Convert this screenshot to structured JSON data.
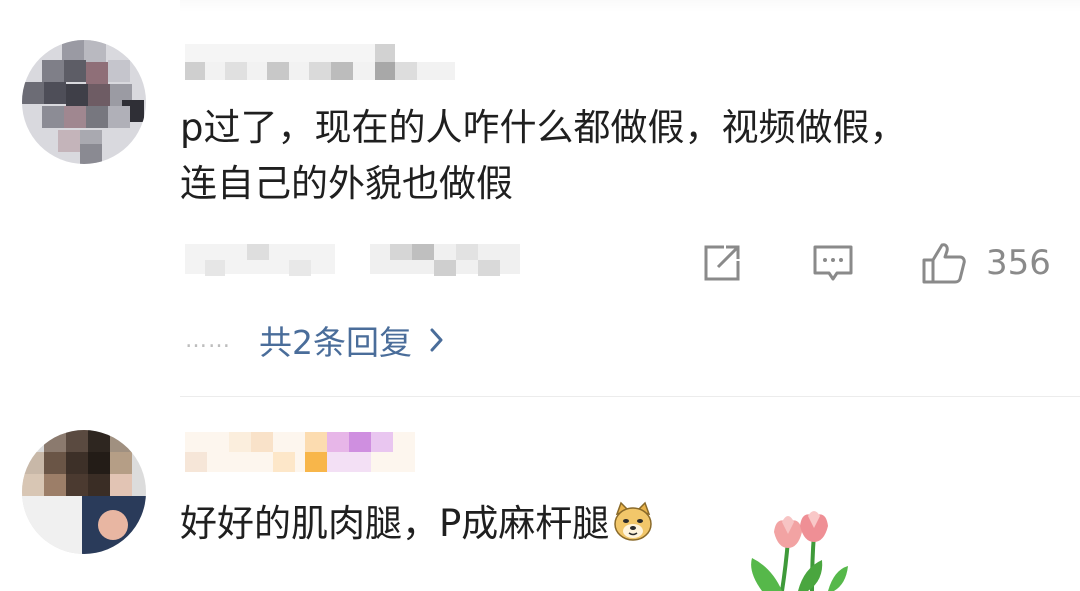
{
  "comments": [
    {
      "text_line1": "p过了，现在的人咋什么都做假，视频做假，",
      "text_line2": "连自己的外貌也做假",
      "actions": {
        "share_icon": "share-icon",
        "comment_icon": "comment-icon",
        "like_icon": "thumbs-up-icon",
        "like_count": "356"
      },
      "replies": {
        "dots": "……",
        "label": "共2条回复"
      }
    },
    {
      "text": "好好的肌肉腿，P成麻杆腿",
      "emoji": "doge-emoji",
      "decoration": "tulip-sticker"
    }
  ],
  "colors": {
    "link": "#4a6d9a",
    "icon_gray": "#8a8a8a",
    "text": "#1f1f1f",
    "divider": "#ececec"
  }
}
